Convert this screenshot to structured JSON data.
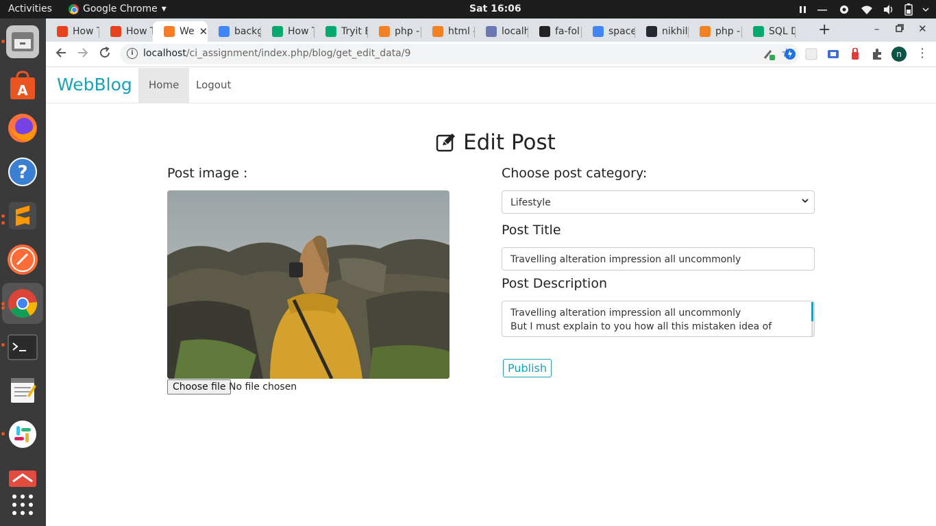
{
  "system_bar": {
    "activities": "Activities",
    "app_name": "Google Chrome",
    "app_menu_arrow": "▾",
    "clock": "Sat 16:06"
  },
  "dock": {
    "icons": [
      "files-icon",
      "software-store-icon",
      "firefox-icon",
      "help-icon",
      "sublime-text-icon",
      "postman-icon",
      "chrome-icon",
      "terminal-icon",
      "text-editor-icon",
      "slack-icon",
      "app-icon",
      "show-apps-icon"
    ]
  },
  "tabs": [
    {
      "title": "How T",
      "favicon": "PS",
      "color": "#e8411d"
    },
    {
      "title": "How T",
      "favicon": "PS",
      "color": "#e8411d"
    },
    {
      "title": "We",
      "favicon": "xampp",
      "color": "#fb7a24",
      "active": true
    },
    {
      "title": "backg",
      "favicon": "G",
      "color": "#4285f4"
    },
    {
      "title": "How T",
      "favicon": "w3",
      "color": "#04aa6d"
    },
    {
      "title": "Tryit E",
      "favicon": "w3",
      "color": "#04aa6d"
    },
    {
      "title": "php - i",
      "favicon": "so",
      "color": "#f48024"
    },
    {
      "title": "html -",
      "favicon": "so",
      "color": "#f48024"
    },
    {
      "title": "localh",
      "favicon": "pma",
      "color": "#6c78af"
    },
    {
      "title": "fa-fol",
      "favicon": "fa",
      "color": "#222222"
    },
    {
      "title": "space",
      "favicon": "G",
      "color": "#4285f4"
    },
    {
      "title": "nikhil",
      "favicon": "gh",
      "color": "#24292e"
    },
    {
      "title": "php - ",
      "favicon": "so",
      "color": "#f48024"
    },
    {
      "title": "SQL D",
      "favicon": "w3",
      "color": "#04aa6d"
    }
  ],
  "browser": {
    "url_host": "localhost",
    "url_path": "/ci_assignment/index.php/blog/get_edit_data/9",
    "profile_initial": "n"
  },
  "nav": {
    "brand": "WebBlog",
    "home": "Home",
    "logout": "Logout"
  },
  "page": {
    "heading": "Edit Post",
    "post_image_label": "Post image :",
    "choose_file": "Choose file",
    "no_file": "No file chosen",
    "category_label": "Choose post category:",
    "category_value": "Lifestyle",
    "title_label": "Post Title",
    "title_value": "Travelling alteration impression all uncommonly",
    "desc_label": "Post Description",
    "desc_line1": "Travelling alteration impression all uncommonly",
    "desc_line2": "But I must explain to you how all this mistaken idea of",
    "publish": "Publish"
  },
  "colors": {
    "accent": "#17a2b8"
  }
}
